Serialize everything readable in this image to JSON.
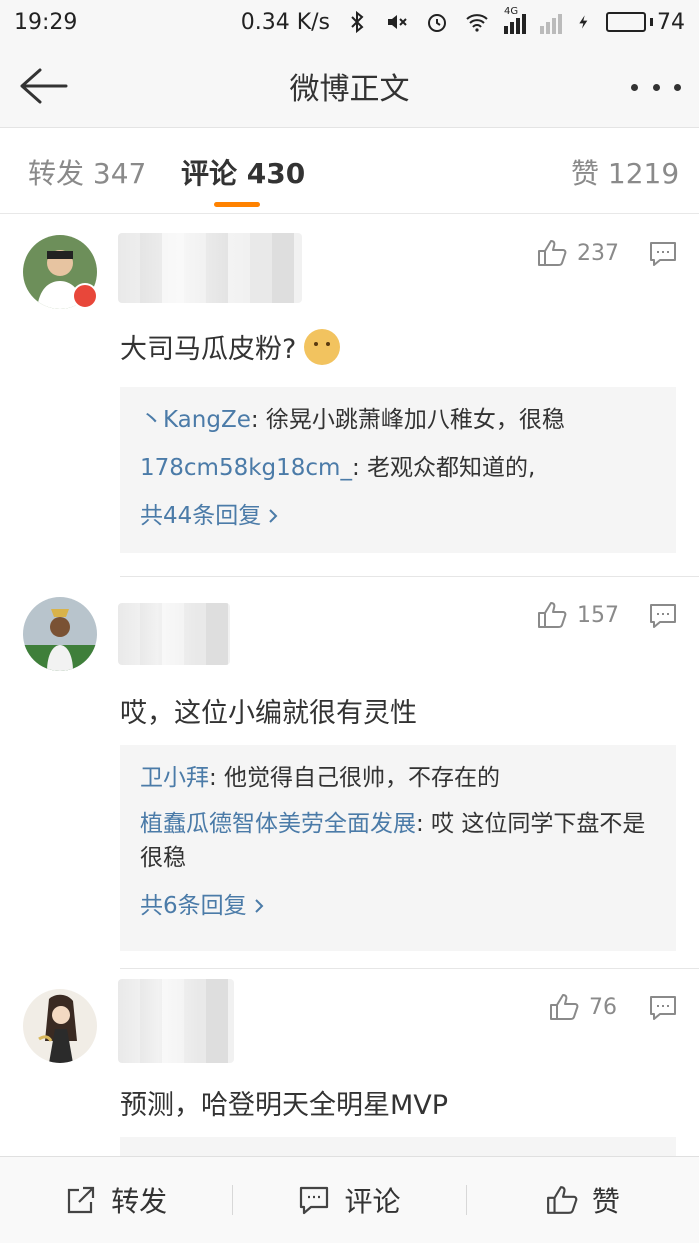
{
  "status": {
    "time": "19:29",
    "speed": "0.34 K/s",
    "signal_label": "4G",
    "battery": "74",
    "battery_level": 0.74
  },
  "nav": {
    "title": "微博正文"
  },
  "tabs": [
    {
      "label": "转发 347"
    },
    {
      "label": "评论 430"
    },
    {
      "label": "赞 1219"
    }
  ],
  "comments": [
    {
      "likes": "237",
      "text": "大司马瓜皮粉?",
      "emoji": "doge-emoji",
      "replies": [
        {
          "name": "丶KangZe",
          "text": ": 徐晃小跳萧峰加八稚女，很稳"
        },
        {
          "name": "178cm58kg18cm_",
          "text": ": 老观众都知道的,"
        }
      ],
      "more": "共44条回复"
    },
    {
      "likes": "157",
      "text": "哎，这位小编就很有灵性",
      "replies": [
        {
          "name": "卫小拜",
          "text": ": 他觉得自己很帅，不存在的"
        },
        {
          "name": "植蠢瓜德智体美劳全面发展",
          "text": ": 哎 这位同学下盘不是很稳"
        }
      ],
      "more": "共6条回复"
    },
    {
      "likes": "76",
      "text": "预测，哈登明天全明星MVP"
    }
  ],
  "bottom": {
    "forward": "转发",
    "comment": "评论",
    "like": "赞"
  }
}
